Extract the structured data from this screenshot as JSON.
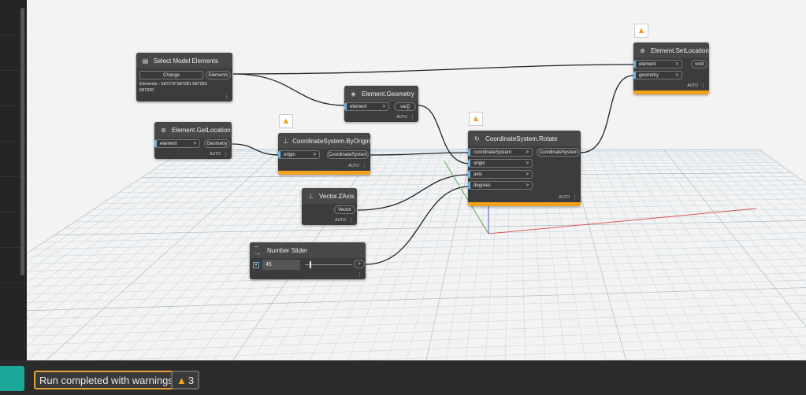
{
  "nodes": {
    "select": {
      "title": "Select Model Elements",
      "button": "Change",
      "output": "Elements",
      "info": "Elements : 587278 587281 587283 587320"
    },
    "geometry": {
      "title": "Element.Geometry",
      "input": "element",
      "output": "var[]",
      "lacing": "AUTO"
    },
    "getloc": {
      "title": "Element.GetLocation",
      "input": "element",
      "output": "Geometry",
      "lacing": "AUTO"
    },
    "byorigin": {
      "title": "CoordinateSystem.ByOrigin",
      "input": "origin",
      "output": "CoordinateSystem",
      "lacing": "AUTO"
    },
    "zaxis": {
      "title": "Vector.ZAxis",
      "output": "Vector",
      "lacing": "AUTO"
    },
    "slider": {
      "title": "Number Slider",
      "value": "45",
      "slider_fraction": 0.1
    },
    "rotate": {
      "title": "CoordinateSystem.Rotate",
      "inputs": [
        "coordinateSystem",
        "origin",
        "axis",
        "degrees"
      ],
      "output": "CoordinateSystem",
      "lacing": "AUTO"
    },
    "setloc": {
      "title": "Element.SetLocation",
      "inputs": [
        "element",
        "geometry"
      ],
      "output": "void",
      "lacing": "AUTO"
    }
  },
  "port_arrow": ">",
  "status": {
    "message": "Run completed with warnings.",
    "warning_count": "3"
  },
  "colors": {
    "warning": "#f2a11c",
    "accent": "#1ba89a",
    "port": "#6ab3de"
  }
}
